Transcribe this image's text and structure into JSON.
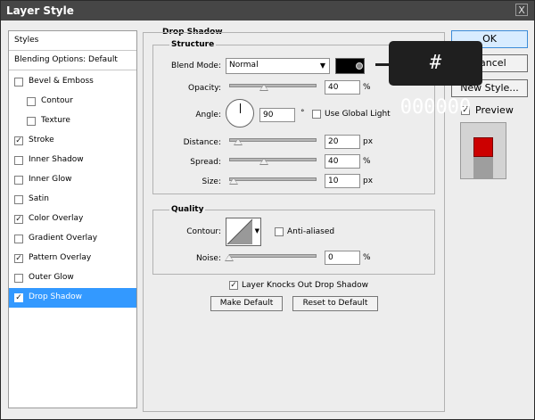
{
  "window": {
    "title": "Layer Style",
    "close_glyph": "X"
  },
  "sidebar": {
    "header": "Styles",
    "blending": "Blending Options: Default",
    "items": [
      {
        "label": "Bevel & Emboss",
        "checked": false
      },
      {
        "label": "Contour",
        "checked": false
      },
      {
        "label": "Texture",
        "checked": false
      },
      {
        "label": "Stroke",
        "checked": true
      },
      {
        "label": "Inner Shadow",
        "checked": false
      },
      {
        "label": "Inner Glow",
        "checked": false
      },
      {
        "label": "Satin",
        "checked": false
      },
      {
        "label": "Color Overlay",
        "checked": true
      },
      {
        "label": "Gradient Overlay",
        "checked": false
      },
      {
        "label": "Pattern Overlay",
        "checked": true
      },
      {
        "label": "Outer Glow",
        "checked": false
      },
      {
        "label": "Drop Shadow",
        "checked": true,
        "selected": true
      }
    ]
  },
  "panel": {
    "title": "Drop Shadow",
    "structure": {
      "title": "Structure",
      "blend_mode_label": "Blend Mode:",
      "blend_mode_value": "Normal",
      "shadow_color": "#000000",
      "opacity_label": "Opacity:",
      "opacity_value": "40",
      "opacity_unit": "%",
      "opacity_level": 0.4,
      "angle_label": "Angle:",
      "angle_value": "90",
      "angle_unit": "°",
      "use_global_light_label": "Use Global Light",
      "use_global_light_checked": false,
      "distance_label": "Distance:",
      "distance_value": "20",
      "distance_unit": "px",
      "distance_level": 0.1,
      "spread_label": "Spread:",
      "spread_value": "40",
      "spread_unit": "%",
      "spread_level": 0.4,
      "size_label": "Size:",
      "size_value": "10",
      "size_unit": "px",
      "size_level": 0.05
    },
    "quality": {
      "title": "Quality",
      "contour_label": "Contour:",
      "anti_aliased_label": "Anti-aliased",
      "anti_aliased_checked": false,
      "noise_label": "Noise:",
      "noise_value": "0",
      "noise_unit": "%",
      "noise_level": 0
    },
    "knockout_label": "Layer Knocks Out Drop Shadow",
    "knockout_checked": true,
    "make_default_label": "Make Default",
    "reset_default_label": "Reset to Default"
  },
  "actions": {
    "ok_label": "OK",
    "cancel_label": "Cancel",
    "new_style_label": "New Style...",
    "preview_label": "Preview",
    "preview_checked": true
  },
  "tooltip": {
    "text": "# 000000"
  },
  "colors": {
    "accent": "#3399ff",
    "preview_fill": "#cc0000",
    "dark": "#464646"
  },
  "icons": {
    "check": "✓",
    "dropdown": "▼"
  }
}
